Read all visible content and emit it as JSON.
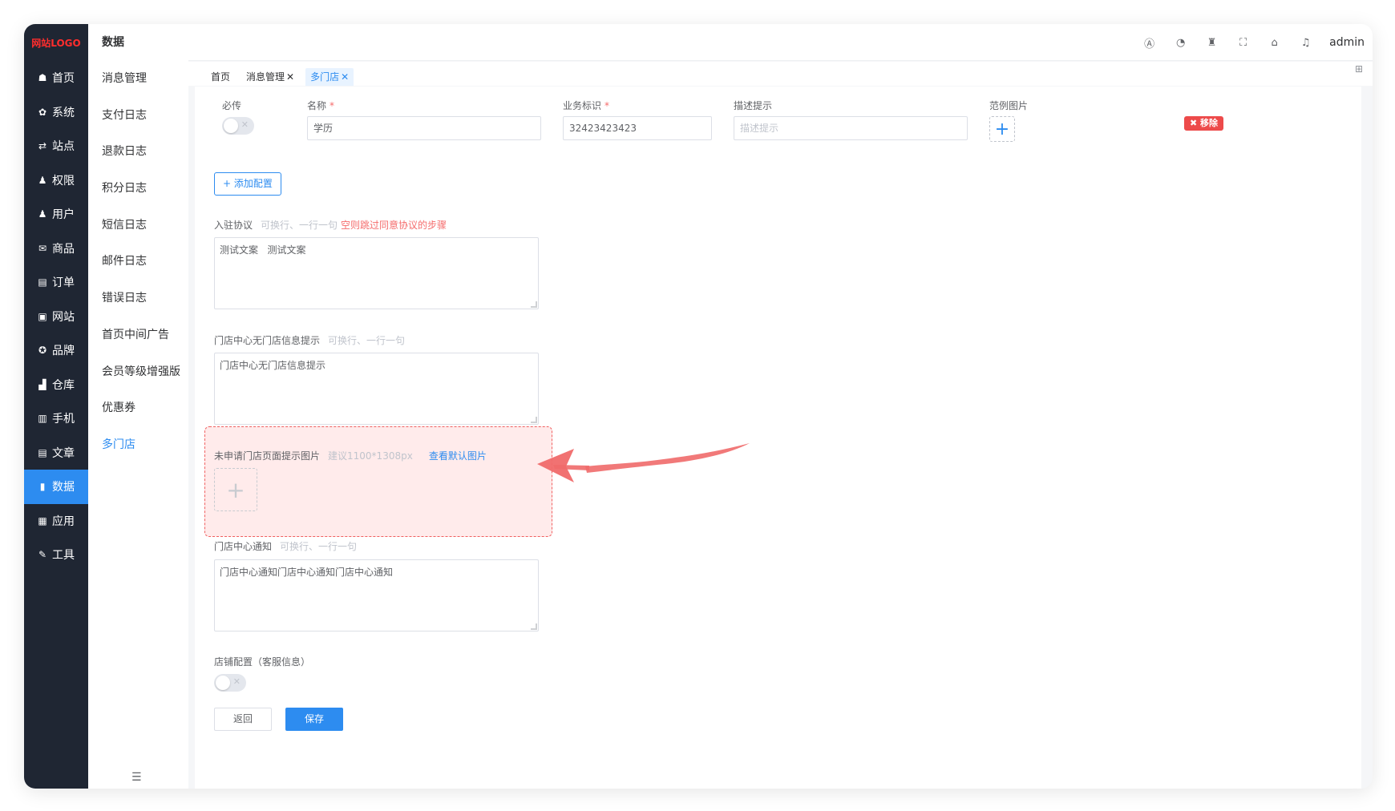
{
  "logo": "网站LOGO",
  "nav": [
    {
      "icon": "☗",
      "label": "首页"
    },
    {
      "icon": "✿",
      "label": "系统"
    },
    {
      "icon": "⇄",
      "label": "站点"
    },
    {
      "icon": "♟",
      "label": "权限"
    },
    {
      "icon": "♟",
      "label": "用户"
    },
    {
      "icon": "✉",
      "label": "商品"
    },
    {
      "icon": "▤",
      "label": "订单"
    },
    {
      "icon": "▣",
      "label": "网站"
    },
    {
      "icon": "✪",
      "label": "品牌"
    },
    {
      "icon": "▟",
      "label": "仓库"
    },
    {
      "icon": "▥",
      "label": "手机"
    },
    {
      "icon": "▤",
      "label": "文章"
    },
    {
      "icon": "▮",
      "label": "数据"
    },
    {
      "icon": "▦",
      "label": "应用"
    },
    {
      "icon": "✎",
      "label": "工具"
    }
  ],
  "submenu": {
    "title": "数据",
    "items": [
      "消息管理",
      "支付日志",
      "退款日志",
      "积分日志",
      "短信日志",
      "邮件日志",
      "错误日志",
      "首页中间广告",
      "会员等级增强版",
      "优惠券",
      "多门店"
    ],
    "collapse_icon": "☰"
  },
  "header": {
    "icons": [
      "Ⓐ",
      "◔",
      "♜",
      "⛶",
      "⌂",
      "♫"
    ],
    "user": "admin"
  },
  "tabs": [
    {
      "label": "首页",
      "closable": false
    },
    {
      "label": "消息管理",
      "closable": true
    },
    {
      "label": "多门店",
      "closable": true
    }
  ],
  "tabs_more": "⊞",
  "form": {
    "config_row": {
      "required_label": "必传",
      "name_label": "名称",
      "name_value": "学历",
      "biz_label": "业务标识",
      "biz_value": "32423423423",
      "desc_label": "描述提示",
      "desc_placeholder": "描述提示",
      "sample_label": "范例图片",
      "remove_label": "✖ 移除"
    },
    "add_config": "+ 添加配置",
    "agreement": {
      "label": "入驻协议",
      "hint": "可换行、一行一句",
      "hint_red": "空则跳过同意协议的步骤",
      "value": "测试文案   测试文案"
    },
    "no_store": {
      "label": "门店中心无门店信息提示",
      "hint": "可换行、一行一句",
      "value": "门店中心无门店信息提示"
    },
    "apply_image": {
      "label": "未申请门店页面提示图片",
      "hint": "建议1100*1308px",
      "link": "查看默认图片"
    },
    "notice": {
      "label": "门店中心通知",
      "hint": "可换行、一行一句",
      "value": "门店中心通知门店中心通知门店中心通知"
    },
    "shop_config": {
      "label": "店铺配置（客服信息）"
    },
    "back": "返回",
    "save": "保存"
  },
  "colors": {
    "primary": "#2d8cf0",
    "nav_bg": "#1f2633",
    "danger": "#ed4a4a",
    "highlight": "#f06060"
  }
}
